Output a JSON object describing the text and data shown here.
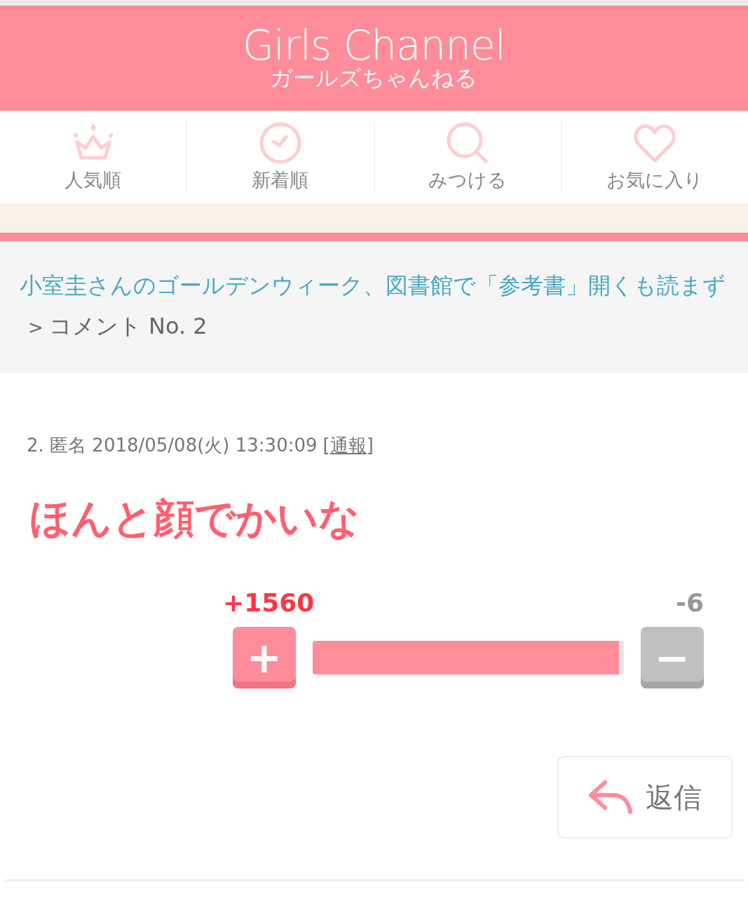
{
  "header": {
    "logo": "Girls Channel",
    "logo_sub": "ガールズちゃんねる"
  },
  "nav": [
    {
      "label": "人気順",
      "kind": "crown"
    },
    {
      "label": "新着順",
      "kind": "clock"
    },
    {
      "label": "みつける",
      "kind": "search"
    },
    {
      "label": "お気に入り",
      "kind": "heart"
    }
  ],
  "breadcrumb": {
    "topic": "小室圭さんのゴールデンウィーク、図書館で「参考書」開くも読まず",
    "separator": ">",
    "current": "コメント No. 2"
  },
  "comment": {
    "meta": "2. 匿名 2018/05/08(火) 13:30:09",
    "report": "[通報]",
    "body": "ほんと顔でかいな",
    "votes": {
      "plus_count": "+1560",
      "minus_count": "-6",
      "plus_icon": "+",
      "minus_icon": "−",
      "level": 0.985
    },
    "reply": "返信"
  }
}
